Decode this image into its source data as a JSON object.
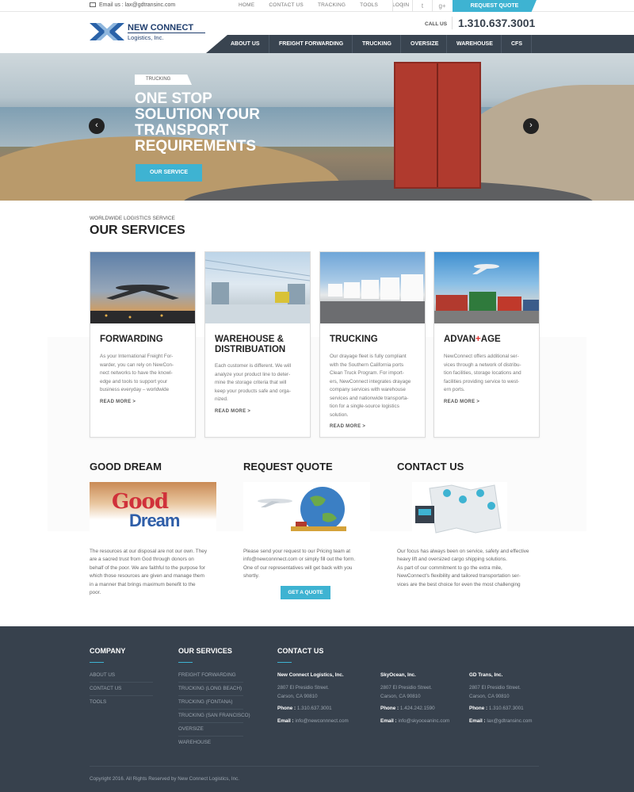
{
  "topbar": {
    "email": "Email us : lax@gdtransinc.com",
    "links": [
      "HOME",
      "CONTACT US",
      "TRACKING",
      "TOOLS",
      "LOGIN"
    ],
    "social_icons": [
      "facebook-icon",
      "twitter-icon",
      "google-plus-icon"
    ],
    "social_glyphs": [
      "f",
      "t",
      "g+"
    ],
    "request_quote": "REQUEST QUOTE"
  },
  "header": {
    "logo_name": "NEW CONNECT",
    "logo_sub": "Logistics, Inc.",
    "call_label": "CALL US",
    "phone": "1.310.637.3001"
  },
  "nav": [
    "ABOUT US",
    "FREIGHT FORWARDING",
    "TRUCKING",
    "OVERSIZE",
    "WAREHOUSE",
    "CFS"
  ],
  "hero": {
    "tag": "TRUCKING",
    "title_lines": [
      "ONE STOP",
      "SOLUTION YOUR",
      "TRANSPORT",
      "REQUIREMENTS"
    ],
    "button": "OUR SERVICE",
    "prev": "‹",
    "next": "›"
  },
  "services": {
    "kicker": "WORLDWIDE LOGISTICS SERVICE",
    "title": "OUR SERVICES",
    "cards": [
      {
        "title_lines": [
          "FORWARDING"
        ],
        "text_lines": [
          "As your International Freight For-",
          "warder, you can rely on NewCon-",
          "nect networks to have the knowl-",
          "edge and tools to support your",
          "business everyday – worldwide"
        ],
        "more": "READ MORE >"
      },
      {
        "title_lines": [
          "WAREHOUSE &",
          "DISTRIBUATION"
        ],
        "text_lines": [
          "Each customer is different.  We will",
          "analyze your product line to deter-",
          "mine the storage criteria that will",
          "keep your products safe and orga-",
          "nized."
        ],
        "more": "READ MORE >"
      },
      {
        "title_lines": [
          "TRUCKING"
        ],
        "text_lines": [
          "Our drayage fleet is fully compliant",
          "with the Southern California ports",
          "Clean Truck Program.  For import-",
          "ers, NewConnect integrates drayage",
          "company services with warehouse",
          "services and nationwide transporta-",
          "tion for a single-source logistics",
          "solution."
        ],
        "more": "READ MORE >"
      },
      {
        "title_pre": "ADVAN",
        "title_plus": "+",
        "title_post": "AGE",
        "text_lines": [
          "NewConnect offers additional ser-",
          "vices through a network of distribu-",
          "tion facilities, storage locations and",
          "facilities providing service to west-",
          "ern ports."
        ],
        "more": "READ MORE >"
      }
    ]
  },
  "good_dream": {
    "title": "GOOD DREAM",
    "logo_top": "Good",
    "logo_bottom": "Dream",
    "text_lines": [
      "The resources at our disposal are not our own. They",
      "are a sacred trust from God through donors on",
      "behalf of the poor. We are faithful to the purpose for",
      "which those resources are given and manage them",
      "in a manner that brings maximum benefit to the",
      "poor."
    ]
  },
  "request_quote": {
    "title": "REQUEST QUOTE",
    "text_lines": [
      "Please send your request to our Pricing team at",
      "info@newconnnect.com or simply fill out the form.",
      "One of our representatives will get back with you",
      "shortly."
    ],
    "button": "GET A QUOTE"
  },
  "contact_us": {
    "title": "CONTACT US",
    "text_lines": [
      "Our focus has always been on service, safety and effective",
      "heavy lift and oversized cargo shipping solutions.",
      "As part of our commitment to go the extra mile,",
      "NewConnect's flexibility and tailored transportation ser-",
      "vices are the best choice for even the most challenging"
    ]
  },
  "footer": {
    "company_title": "COMPANY",
    "company_links": [
      "ABOUT US",
      "CONTACT US",
      "TOOLS"
    ],
    "services_title": "OUR SERVICES",
    "services_links": [
      "FREIGHT FORWARDING",
      "TRUCKING (LONG BEACH)",
      "TRUCKING (FONTANA)",
      "TRUCKING (SAN FRANCISCO)",
      "OVERSIZE",
      "WAREHOUSE"
    ],
    "contact_title": "CONTACT US",
    "phone_label": "Phone :",
    "email_label": "Email :",
    "offices": [
      {
        "name": "New Connect Logistics, Inc.",
        "addr1": "2807 El Presidio Street.",
        "addr2": "Carson, CA 90810",
        "phone": "1.310.637.3001",
        "email": "info@newconnnect.com"
      },
      {
        "name": "SkyOcean, Inc.",
        "addr1": "2807 El Presidio Street.",
        "addr2": "Carson, CA 90810",
        "phone": "1.424.242.1590",
        "email": "info@skyoceaninc.com"
      },
      {
        "name": "GD Trans, Inc.",
        "addr1": "2807 El Presidio Street.",
        "addr2": "Carson, CA 90810",
        "phone": "1.310.637.3001",
        "email": "lax@gdtransinc.com"
      }
    ],
    "copyright": "Copyright 2016. All Rights Reserved by New Connect Logistics, Inc."
  },
  "colors": {
    "accent": "#3eb3d2",
    "dark": "#37414d",
    "plus_red": "#e0322f"
  }
}
